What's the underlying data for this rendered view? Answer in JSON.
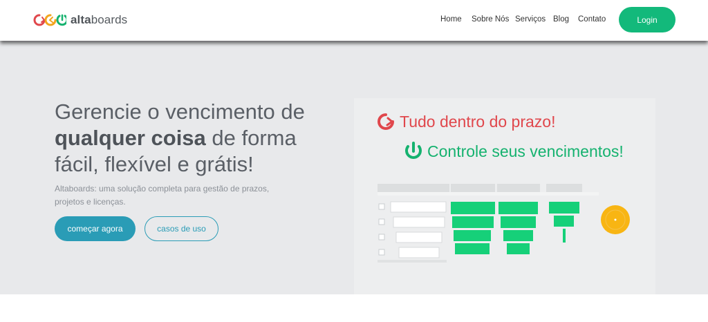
{
  "brand": {
    "name_bold": "alta",
    "name_light": "boards",
    "colors": {
      "red": "#e0474c",
      "orange": "#f2a51e",
      "green": "#15b26f"
    }
  },
  "nav": {
    "links": [
      "Home",
      "Sobre Nós",
      "Serviços",
      "Blog",
      "Contato"
    ],
    "login_label": "Login",
    "login_color": "#13b97b"
  },
  "hero": {
    "headline_line1": "Gerencie o vencimento de",
    "headline_bold": "qualquer coisa",
    "headline_line2_rest": " de forma",
    "headline_line3": "fácil, flexível e grátis!",
    "subtitle": "Altaboards: uma solução completa para gestão de prazos, projetos e licenças.",
    "primary_cta": "começar agora",
    "secondary_cta": "casos de uso",
    "cta_color": "#2a9cb6"
  },
  "illustration": {
    "line1": "Tudo dentro do prazo!",
    "line2": "Controle seus vencimentos!"
  }
}
